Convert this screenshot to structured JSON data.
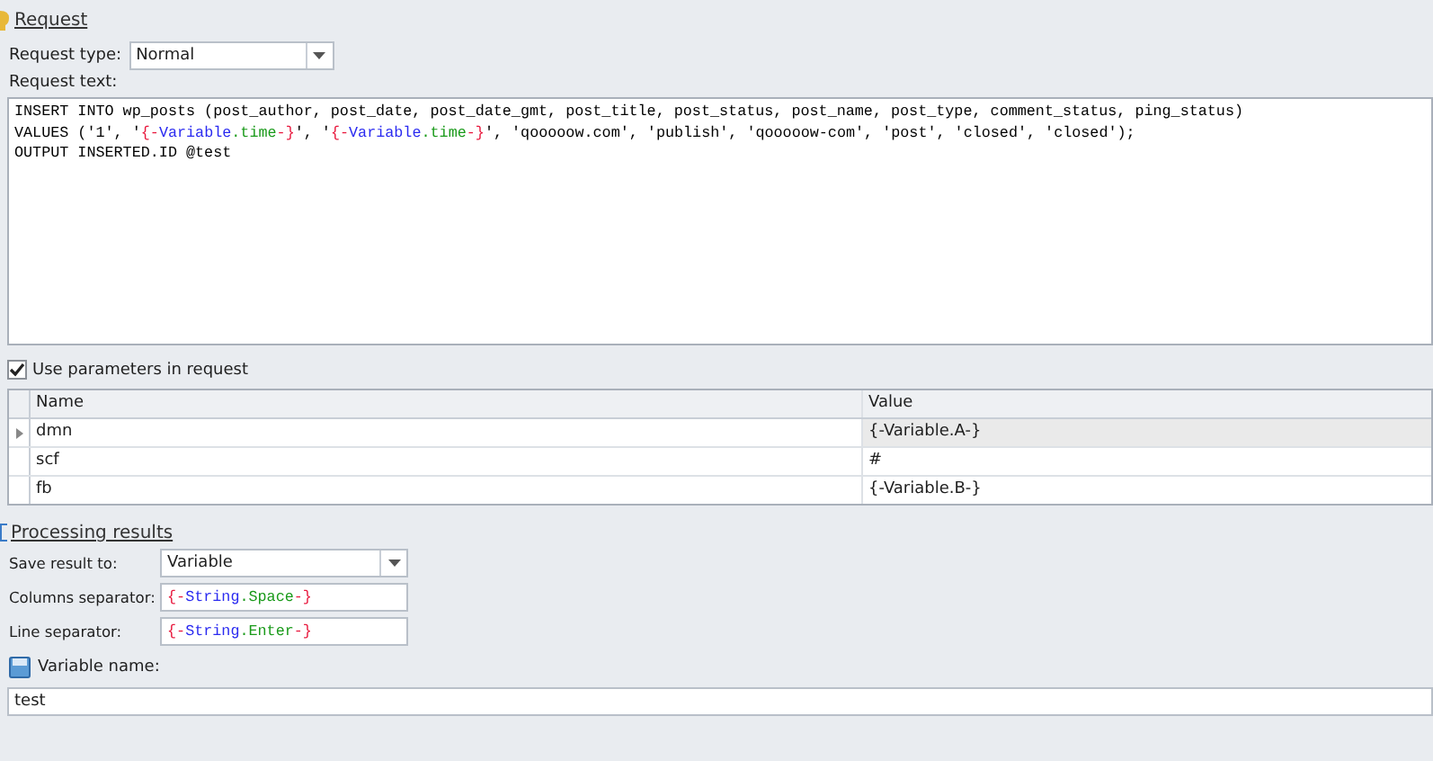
{
  "request": {
    "title": "Request",
    "type_label": "Request type:",
    "type_value": "Normal",
    "text_label": "Request text:",
    "lines": [
      [
        {
          "kind": "plain",
          "text": "INSERT INTO wp_posts (post_author, post_date, post_date_gmt, post_title, post_status, post_name, post_type, comment_status, ping_status)"
        }
      ],
      [
        {
          "kind": "plain",
          "text": "VALUES ('1', '"
        },
        {
          "kind": "brace",
          "text": "{-"
        },
        {
          "kind": "object",
          "text": "Variable"
        },
        {
          "kind": "member",
          "text": ".time"
        },
        {
          "kind": "brace",
          "text": "-}"
        },
        {
          "kind": "plain",
          "text": "', '"
        },
        {
          "kind": "brace",
          "text": "{-"
        },
        {
          "kind": "object",
          "text": "Variable"
        },
        {
          "kind": "member",
          "text": ".time"
        },
        {
          "kind": "brace",
          "text": "-}"
        },
        {
          "kind": "plain",
          "text": "', 'qooooow.com', 'publish', 'qooooow-com', 'post', 'closed', 'closed');"
        }
      ],
      [
        {
          "kind": "plain",
          "text": "OUTPUT INSERTED.ID @test"
        }
      ]
    ],
    "use_params": {
      "label": "Use parameters in request",
      "checked": true
    },
    "params": {
      "columns": [
        "Name",
        "Value"
      ],
      "rows": [
        {
          "name": "dmn",
          "value": "{-Variable.A-}",
          "selected": true
        },
        {
          "name": "scf",
          "value": "#",
          "selected": false
        },
        {
          "name": "fb",
          "value": "{-Variable.B-}",
          "selected": false
        }
      ]
    }
  },
  "processing": {
    "title": "Processing results",
    "save_label": "Save result to:",
    "save_value": "Variable",
    "columns_sep_label": "Columns separator:",
    "columns_sep": [
      {
        "kind": "brace",
        "text": "{-"
      },
      {
        "kind": "object",
        "text": "String"
      },
      {
        "kind": "member",
        "text": ".Space"
      },
      {
        "kind": "brace",
        "text": "-}"
      }
    ],
    "line_sep_label": "Line separator:",
    "line_sep": [
      {
        "kind": "brace",
        "text": "{-"
      },
      {
        "kind": "object",
        "text": "String"
      },
      {
        "kind": "member",
        "text": ".Enter"
      },
      {
        "kind": "brace",
        "text": "-}"
      }
    ],
    "var_label": "Variable name:",
    "var_value": "test"
  }
}
